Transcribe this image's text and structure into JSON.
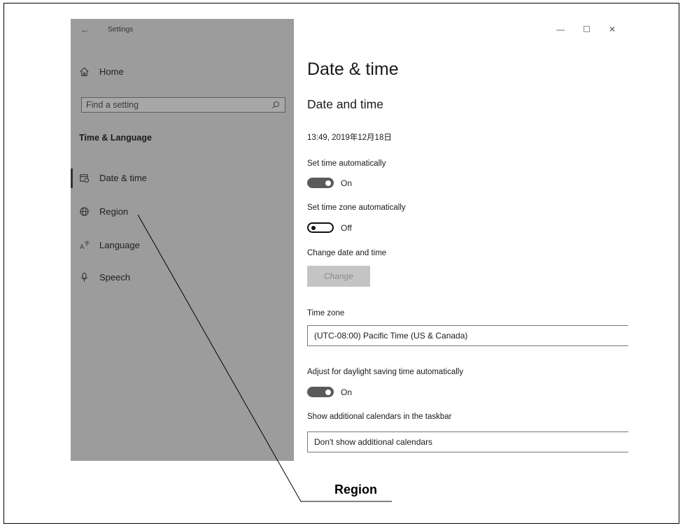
{
  "titlebar": {
    "back_icon": "back-arrow-icon",
    "app_title": "Settings",
    "controls": [
      "—",
      "☐",
      "✕"
    ]
  },
  "sidebar": {
    "home_label": "Home",
    "search_placeholder": "Find a setting",
    "section_title": "Time & Language",
    "items": [
      {
        "label": "Date & time",
        "icon": "calendar-clock-icon",
        "active": true
      },
      {
        "label": "Region",
        "icon": "globe-icon"
      },
      {
        "label": "Language",
        "icon": "language-icon"
      },
      {
        "label": "Speech",
        "icon": "microphone-icon"
      }
    ]
  },
  "main": {
    "page_title": "Date & time",
    "section_title": "Date and time",
    "current_datetime": "13:49, 2019年12月18日",
    "set_time_auto": {
      "label": "Set time automatically",
      "state": "On"
    },
    "set_timezone_auto": {
      "label": "Set time zone automatically",
      "state": "Off"
    },
    "change_date": {
      "label": "Change date and time",
      "button": "Change"
    },
    "time_zone": {
      "label": "Time zone",
      "value": "(UTC-08:00) Pacific Time (US & Canada)"
    },
    "daylight": {
      "label": "Adjust for daylight saving time automatically",
      "state": "On"
    },
    "calendars": {
      "label": "Show additional calendars in the taskbar",
      "value": "Don't show additional calendars"
    }
  },
  "callout": {
    "label": "Region"
  }
}
